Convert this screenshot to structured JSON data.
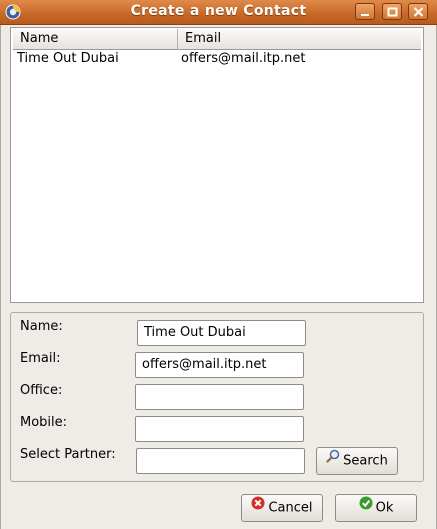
{
  "window": {
    "title": "Create a new Contact"
  },
  "table": {
    "columns": [
      "Name",
      "Email"
    ],
    "rows": [
      {
        "name": "Time Out Dubai",
        "email": "offers@mail.itp.net"
      }
    ]
  },
  "form": {
    "name_label": "Name:",
    "name_value": "Time Out Dubai",
    "email_label": "Email:",
    "email_value": "offers@mail.itp.net",
    "office_label": "Office:",
    "office_value": "",
    "mobile_label": "Mobile:",
    "mobile_value": "",
    "partner_label": "Select Partner:",
    "partner_value": "",
    "search_label": "Search"
  },
  "buttons": {
    "cancel": "Cancel",
    "ok": "Ok"
  },
  "icons": {
    "app": "app-icon",
    "minimize": "minimize-icon",
    "maximize": "maximize-icon",
    "close": "close-icon",
    "search": "magnifier-icon",
    "cancel": "cancel-icon",
    "ok": "ok-check-icon"
  },
  "colors": {
    "titlebar": "#c96a2a",
    "cancel_icon": "#d0302a",
    "ok_icon": "#3a9a2a"
  }
}
